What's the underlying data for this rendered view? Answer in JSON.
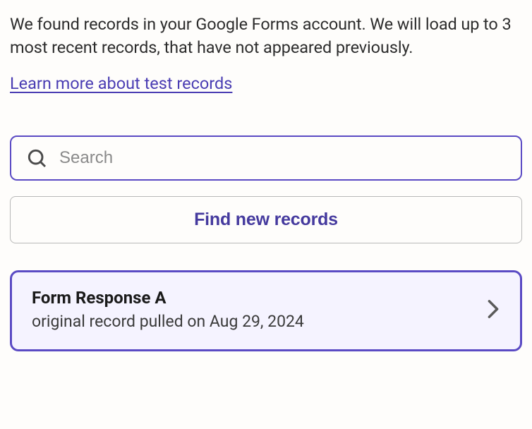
{
  "description": "We found records in your Google Forms account. We will load up to 3 most recent records, that have not appeared previously.",
  "learn_more": "Learn more about test records",
  "search": {
    "placeholder": "Search"
  },
  "find_button": "Find new records",
  "records": [
    {
      "title": "Form Response A",
      "subtitle": "original record pulled on Aug 29, 2024"
    }
  ]
}
